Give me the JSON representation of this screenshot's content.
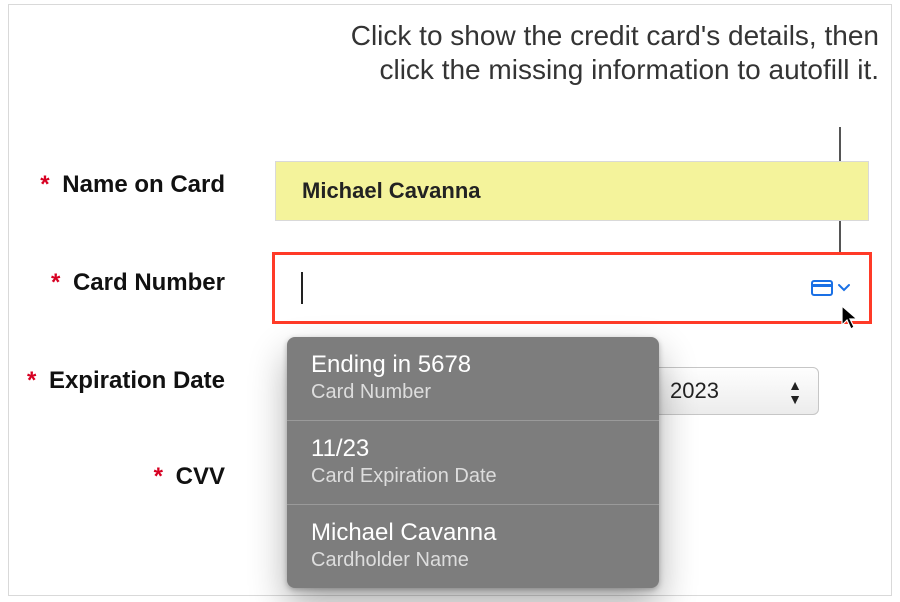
{
  "instruction": "Click to show the credit card's details, then click the missing information to autofill it.",
  "labels": {
    "name_on_card": "Name on Card",
    "card_number": "Card Number",
    "expiration_date": "Expiration Date",
    "cvv": "CVV"
  },
  "fields": {
    "name_on_card_value": "Michael Cavanna",
    "card_number_value": ""
  },
  "expiration_year": "2023",
  "autofill_options": [
    {
      "primary": "Ending in 5678",
      "secondary": "Card Number"
    },
    {
      "primary": "11/23",
      "secondary": "Card Expiration Date"
    },
    {
      "primary": "Michael Cavanna",
      "secondary": "Cardholder Name"
    }
  ]
}
